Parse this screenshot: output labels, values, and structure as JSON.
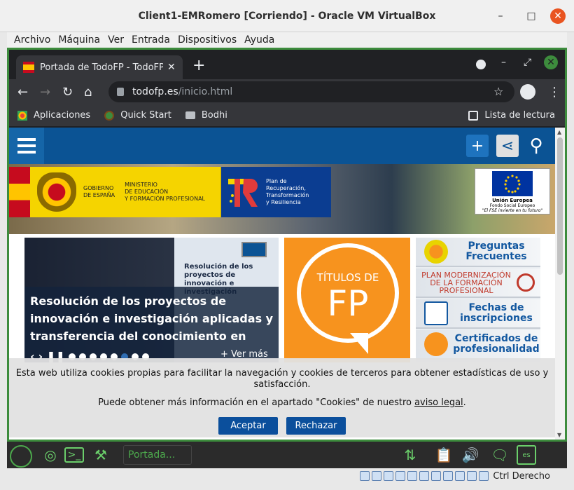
{
  "window": {
    "title": "Client1-EMRomero [Corriendo] - Oracle VM VirtualBox",
    "minimize": "–",
    "maximize": "□",
    "close": "✕"
  },
  "menu": [
    "Archivo",
    "Máquina",
    "Ver",
    "Entrada",
    "Dispositivos",
    "Ayuda"
  ],
  "browser": {
    "tab_title": "Portada de TodoFP - TodoFP",
    "tab_close": "✕",
    "new_tab": "+",
    "url_host": "todofp.es",
    "url_path": "/inicio.html",
    "bookmarks": [
      "Aplicaciones",
      "Quick Start",
      "Bodhi"
    ],
    "reading_list": "Lista de lectura"
  },
  "site": {
    "gov_line1": "GOBIERNO",
    "gov_line2": "DE ESPAÑA",
    "ministry_line1": "MINISTERIO",
    "ministry_line2": "DE EDUCACIÓN",
    "ministry_line3": "Y FORMACIÓN PROFESIONAL",
    "plan_line1": "Plan de",
    "plan_line2": "Recuperación,",
    "plan_line3": "Transformación",
    "plan_line4": "y Resiliencia",
    "eu_line1": "Unión Europea",
    "eu_line2": "Fondo Social Europeo",
    "eu_line3": "\"El FSE invierte en tu futuro\"",
    "slider_small": "Resolución de los proyectos de innovación e investigación",
    "slider_caption": "Resolución de los proyectos de innovación e investigación aplicadas y transferencia del conocimiento en",
    "slider_more": "+ Ver más",
    "titulos_line1": "TÍTULOS DE",
    "titulos_line2": "FP",
    "links": [
      "Preguntas Frecuentes",
      "PLAN MODERNIZACIÓN DE LA FORMACIÓN PROFESIONAL",
      "Fechas de inscripciones",
      "Certificados de profesionalidad"
    ],
    "header_buttons": {
      "plus": "+",
      "share": "⋖",
      "search": "⚲"
    }
  },
  "cookie": {
    "line1": "Esta web utiliza cookies propias para facilitar la navegación y cookies de terceros para obtener estadísticas de uso y satisfacción.",
    "line2_pre": "Puede obtener más información en el apartado \"Cookies\" de nuestro ",
    "line2_link": "aviso legal",
    "line2_post": ".",
    "accept": "Aceptar",
    "reject": "Rechazar"
  },
  "taskbar": {
    "pill_label": "Portada..."
  },
  "status": {
    "host_key": "Ctrl Derecho"
  },
  "colors": {
    "accent_green": "#3d8c3d",
    "site_blue": "#0b5394",
    "orange": "#f7931e",
    "ubuntu_orange": "#e95420"
  }
}
